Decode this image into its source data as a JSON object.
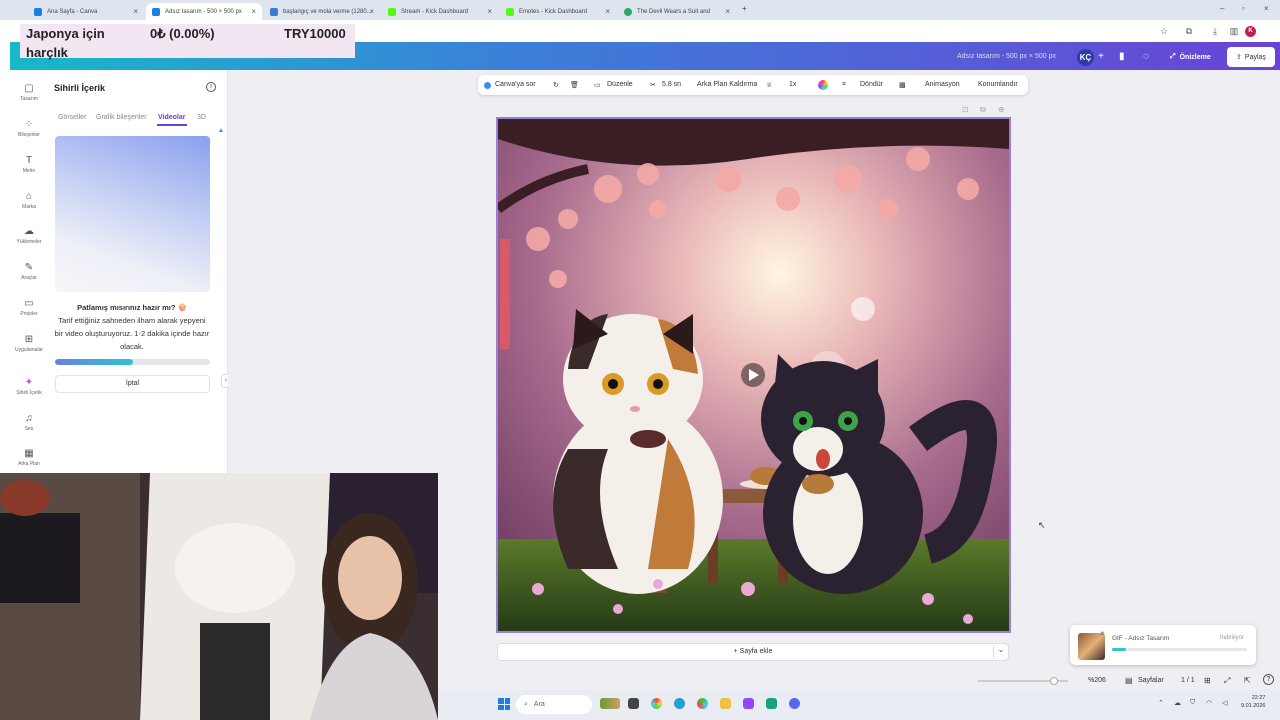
{
  "browser": {
    "tabs": [
      {
        "title": "Ana Sayfa - Canva",
        "color": "#1a7fe0"
      },
      {
        "title": "Adsız tasarım - 500 × 500 px",
        "color": "#1a7fe0"
      },
      {
        "title": "başlangıç ve mola verme (1280...",
        "color": "#3a7ad0"
      },
      {
        "title": "Stream - Kick Dashboard",
        "color": "#53fc18"
      },
      {
        "title": "Emotes - Kick Dashboard",
        "color": "#53fc18"
      },
      {
        "title": "The Devil Wears a Suit and",
        "color": "#2ca86b"
      }
    ],
    "new_tab": "+",
    "profile_initial": "K"
  },
  "overlay": {
    "line1": "Japonya için",
    "line2": "harçlık",
    "amount": "0₺ (0.00%)",
    "goal": "TRY10000"
  },
  "header": {
    "filename": "Adsız tasarım - 500 px × 500 px",
    "avatar_initials": "KÇ",
    "plus": "+",
    "preview_label": "Önizleme",
    "share_label": "Paylaş"
  },
  "rail": {
    "items": [
      {
        "label": "Tasarım",
        "icon": "▢"
      },
      {
        "label": "Bileşenler",
        "icon": "⁘"
      },
      {
        "label": "Metin",
        "icon": "T"
      },
      {
        "label": "Marka",
        "icon": "⌂"
      },
      {
        "label": "Yüklemeler",
        "icon": "☁"
      },
      {
        "label": "Araçlar",
        "icon": "✎"
      },
      {
        "label": "Projeler",
        "icon": "▭"
      },
      {
        "label": "Uygulamalar",
        "icon": "⊞"
      },
      {
        "label": "Sihirli İçerik",
        "icon": "✦"
      },
      {
        "label": "Ses",
        "icon": "♫"
      },
      {
        "label": "Arka Plan",
        "icon": "▦"
      }
    ]
  },
  "panel": {
    "title": "Sihirli İçerik",
    "tabs": [
      "Görseller",
      "Grafik bileşenler",
      "Videolar",
      "3D"
    ],
    "active_tab": "Videolar",
    "ready_heading": "Patlamış mısırınız hazır mı? 🍿",
    "ready_body": "Tarif ettiğiniz sahneden ilham alarak yepyeni bir video oluşturuyoruz. 1-2 dakika içinde hazır olacak.",
    "progress": 0.5,
    "cancel_label": "İptal",
    "collapse": "‹"
  },
  "toolbar": {
    "ask_canva": "Canva'ya sor",
    "edit": "Düzenle",
    "duration": "5.8 sn",
    "bg_remove": "Arka Plan Kaldırma",
    "speed": "1x",
    "rotate": "Döndür",
    "animation": "Animasyon",
    "position": "Konumlandır"
  },
  "canvas": {
    "add_page": "+ Sayfa ekle",
    "add_page_chevron": "⌄"
  },
  "toast": {
    "title": "GIF - Adsız Tasarım",
    "status": "İndiriliyor",
    "progress": 0.1,
    "close": "×"
  },
  "bottom": {
    "zoom": "%206",
    "pages_label": "Sayfalar",
    "page_count": "1 / 1",
    "help": "?"
  },
  "taskbar": {
    "search_placeholder": "Ara",
    "time": "22:27",
    "date": "9.01.2026"
  },
  "colors": {
    "accent": "#6a43d6",
    "teal": "#17b9c9"
  }
}
